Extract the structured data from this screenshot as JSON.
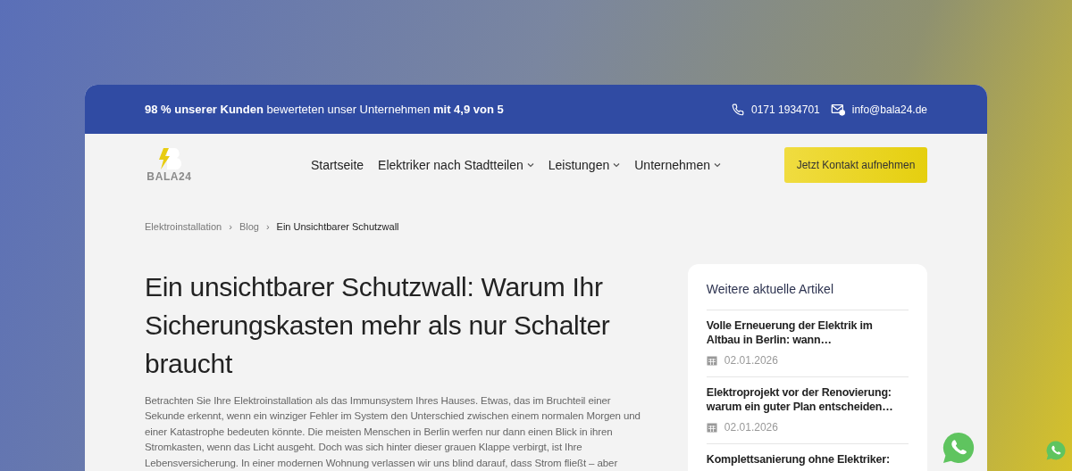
{
  "topbar": {
    "rating": "**98 % unserer Kunden** bewerteten unser Unternehmen **mit 4,9 von 5**",
    "phone": "0171 1934701",
    "email": "info@bala24.de"
  },
  "logo": {
    "text": "BALA24"
  },
  "nav": [
    {
      "label": "Startseite",
      "dropdown": false
    },
    {
      "label": "Elektriker nach Stadtteilen",
      "dropdown": true
    },
    {
      "label": "Leistungen",
      "dropdown": true
    },
    {
      "label": "Unternehmen",
      "dropdown": true
    }
  ],
  "cta": "Jetzt Kontakt aufnehmen",
  "breadcrumb": [
    {
      "label": "Elektroinstallation",
      "current": false
    },
    {
      "label": "Blog",
      "current": false
    },
    {
      "label": "Ein Unsichtbarer Schutzwall",
      "current": true
    }
  ],
  "breadcrumb_separator": "›",
  "article": {
    "title": "Ein unsichtbarer Schutzwall: Warum Ihr Sicherungskasten mehr als nur Schalter braucht",
    "body": "Betrachten Sie Ihre Elektroinstallation als das Immunsystem Ihres Hauses. Etwas, das im Bruchteil einer Sekunde erkennt, wenn ein winziger Fehler im System den Unterschied zwischen einem normalen Morgen und einer Katastrophe bedeuten könnte. Die meisten Menschen in Berlin werfen nur dann einen Blick in ihren Stromkasten, wenn das Licht ausgeht. Doch was sich hinter dieser grauen Klappe verbirgt, ist Ihre Lebensversicherung. In einer modernen Wohnung verlassen wir uns blind darauf, dass Strom fließt – aber"
  },
  "sidebar": {
    "title": "Weitere aktuelle Artikel",
    "articles": [
      {
        "title": "Volle Erneuerung der Elektrik im Altbau in Berlin: wann…",
        "date": "02.01.2026"
      },
      {
        "title": "Elektroprojekt vor der Renovierung: warum ein guter Plan entscheiden…",
        "date": "02.01.2026"
      },
      {
        "title": "Komplettsanierung ohne Elektriker:"
      }
    ]
  }
}
